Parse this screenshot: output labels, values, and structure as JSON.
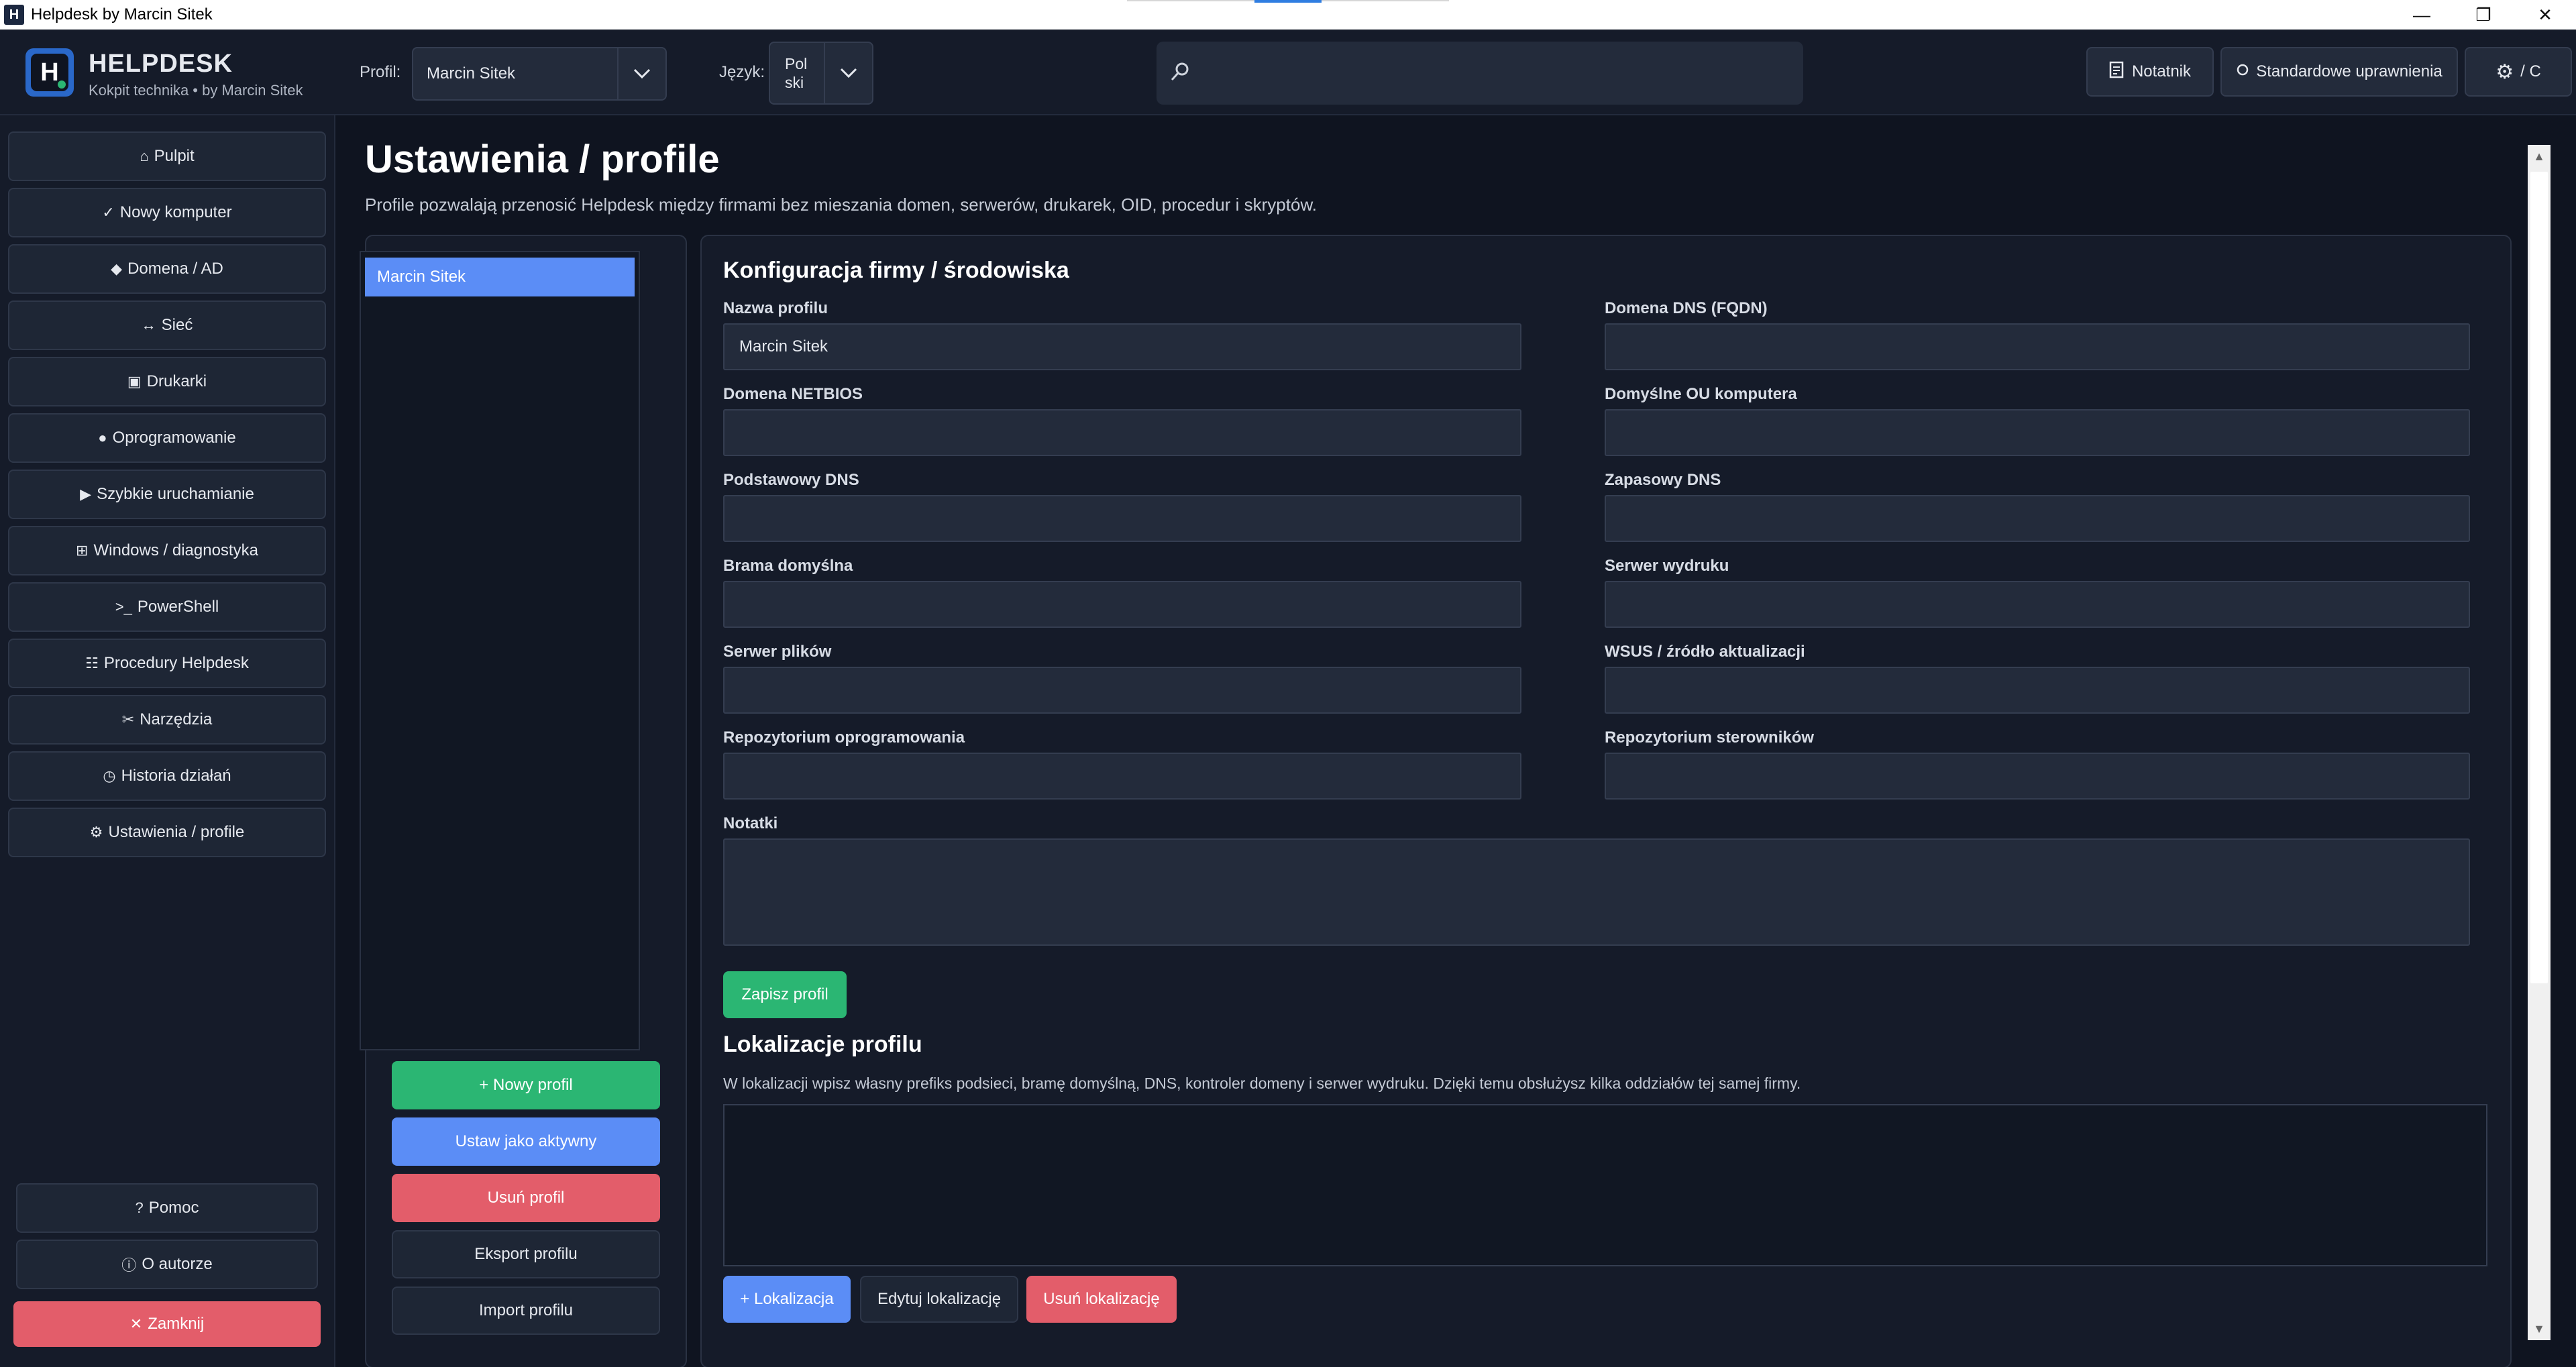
{
  "window": {
    "title": "Helpdesk by Marcin Sitek",
    "icon_text": "H",
    "minimize": "—",
    "maximize": "❐",
    "close": "✕"
  },
  "header": {
    "brand_title": "HELPDESK",
    "brand_subtitle": "Kokpit technika • by Marcin Sitek",
    "logo_letter": "H",
    "profile_label": "Profil:",
    "profile_value": "Marcin Sitek",
    "language_label": "Język:",
    "language_value_line1": "Pol",
    "language_value_line2": "ski",
    "search_placeholder": "",
    "notes_button": "Notatnik",
    "permissions_button": "Standardowe uprawnienia",
    "settings_button": "/ C"
  },
  "sidebar": {
    "items": [
      {
        "icon": "⌂",
        "label": "Pulpit"
      },
      {
        "icon": "✓",
        "label": "Nowy komputer"
      },
      {
        "icon": "◆",
        "label": "Domena / AD"
      },
      {
        "icon": "↔",
        "label": "Sieć"
      },
      {
        "icon": "▣",
        "label": "Drukarki"
      },
      {
        "icon": "●",
        "label": "Oprogramowanie"
      },
      {
        "icon": "▶",
        "label": "Szybkie uruchamianie"
      },
      {
        "icon": "⊞",
        "label": "Windows / diagnostyka"
      },
      {
        "icon": ">_",
        "label": "PowerShell"
      },
      {
        "icon": "☷",
        "label": "Procedury Helpdesk"
      },
      {
        "icon": "✂",
        "label": "Narzędzia"
      },
      {
        "icon": "◷",
        "label": "Historia działań"
      },
      {
        "icon": "⚙",
        "label": "Ustawienia / profile"
      }
    ],
    "help": {
      "icon": "?",
      "label": "Pomoc"
    },
    "about": {
      "icon": "ⓘ",
      "label": "O autorze"
    },
    "close": {
      "icon": "✕",
      "label": "Zamknij"
    }
  },
  "main": {
    "title": "Ustawienia / profile",
    "subtitle": "Profile pozwalają przenosić Helpdesk między firmami bez mieszania domen, serwerów, drukarek, OID, procedur i skryptów.",
    "profiles": [
      "Marcin Sitek"
    ],
    "profile_buttons": {
      "new": "+ Nowy profil",
      "set_active": "Ustaw jako aktywny",
      "delete": "Usuń profil",
      "export": "Eksport profilu",
      "import": "Import profilu"
    },
    "config": {
      "title": "Konfiguracja firmy / środowiska",
      "fields": {
        "profile_name": {
          "label": "Nazwa profilu",
          "value": "Marcin Sitek"
        },
        "dns_domain": {
          "label": "Domena DNS (FQDN)",
          "value": ""
        },
        "netbios": {
          "label": "Domena NETBIOS",
          "value": ""
        },
        "default_ou": {
          "label": "Domyślne OU komputera",
          "value": ""
        },
        "primary_dns": {
          "label": "Podstawowy DNS",
          "value": ""
        },
        "secondary_dns": {
          "label": "Zapasowy DNS",
          "value": ""
        },
        "gateway": {
          "label": "Brama domyślna",
          "value": ""
        },
        "print_server": {
          "label": "Serwer wydruku",
          "value": ""
        },
        "file_server": {
          "label": "Serwer plików",
          "value": ""
        },
        "wsus": {
          "label": "WSUS / źródło aktualizacji",
          "value": ""
        },
        "software_repo": {
          "label": "Repozytorium oprogramowania",
          "value": ""
        },
        "driver_repo": {
          "label": "Repozytorium sterowników",
          "value": ""
        },
        "notes": {
          "label": "Notatki",
          "value": ""
        }
      },
      "save_button": "Zapisz profil"
    },
    "locations": {
      "title": "Lokalizacje profilu",
      "hint": "W lokalizacji wpisz własny prefiks podsieci, bramę domyślną, DNS, kontroler domeny i serwer wydruku. Dzięki temu obsłużysz kilka oddziałów tej samej firmy.",
      "add_button": "+ Lokalizacja",
      "edit_button": "Edytuj lokalizację",
      "delete_button": "Usuń lokalizację"
    }
  },
  "colors": {
    "accent_blue": "#5b8df6",
    "success_green": "#2bb673",
    "danger_red": "#e35d6a",
    "background": "#0f1420",
    "panel": "#151b29"
  }
}
